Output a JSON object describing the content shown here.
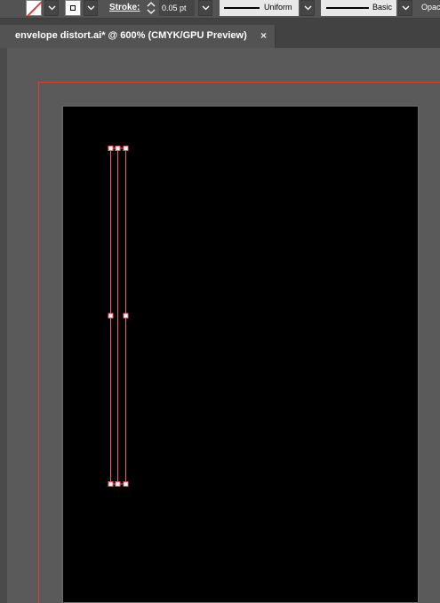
{
  "control_bar": {
    "stroke_label": "Stroke:",
    "stroke_weight": "0.05 pt",
    "variable_width_profile": "Uniform",
    "brush_definition": "Basic",
    "opacity_label": "Opac",
    "fill_icon": "no-fill-swatch",
    "stroke_icon": "stroke-swatch"
  },
  "document": {
    "tab_title": "envelope distort.ai* @ 600% (CMYK/GPU Preview)",
    "close_glyph": "×"
  },
  "colors": {
    "selection": "#f0606a",
    "bleed": "#d6442c",
    "artboard": "#000000",
    "pasteboard": "#5a5a5a"
  }
}
